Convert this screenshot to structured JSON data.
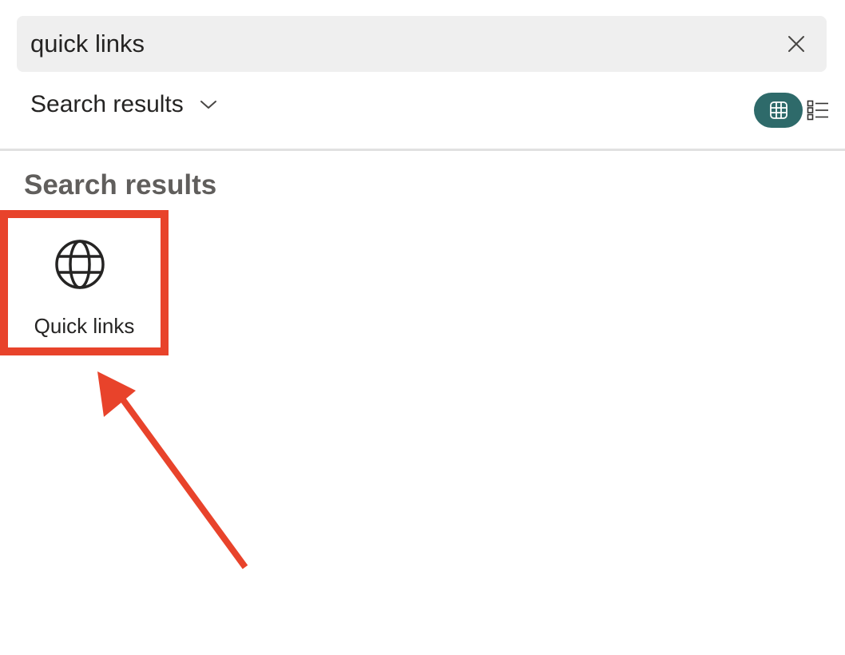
{
  "search": {
    "value": "quick links",
    "clear_icon": "close-icon"
  },
  "scope": {
    "label": "Search results",
    "chevron_icon": "chevron-down-icon"
  },
  "view_toggle": {
    "grid_icon": "grid-view-icon",
    "list_icon": "list-view-icon",
    "active": "grid",
    "active_color": "#2e6a6a"
  },
  "results": {
    "heading": "Search results",
    "items": [
      {
        "label": "Quick links",
        "icon": "globe-icon"
      }
    ]
  },
  "annotation": {
    "highlight_color": "#e8432b",
    "arrow_color": "#e8432b"
  }
}
